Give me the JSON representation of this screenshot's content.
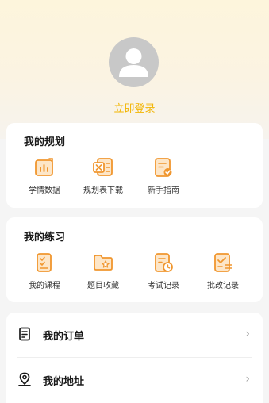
{
  "profile": {
    "login_text": "立即登录"
  },
  "planning": {
    "title": "我的规划",
    "items": [
      {
        "label": "学情数据",
        "icon": "bar-chart-icon"
      },
      {
        "label": "规划表下载",
        "icon": "excel-download-icon"
      },
      {
        "label": "新手指南",
        "icon": "guide-icon"
      }
    ]
  },
  "practice": {
    "title": "我的练习",
    "items": [
      {
        "label": "我的课程",
        "icon": "course-icon"
      },
      {
        "label": "题目收藏",
        "icon": "star-folder-icon"
      },
      {
        "label": "考试记录",
        "icon": "exam-clock-icon"
      },
      {
        "label": "批改记录",
        "icon": "correction-icon"
      }
    ]
  },
  "menu": {
    "orders": {
      "label": "我的订单",
      "icon": "order-icon"
    },
    "address": {
      "label": "我的地址",
      "icon": "location-icon"
    }
  },
  "colors": {
    "accent": "#f2b400",
    "icon_orange": "#f0962e"
  }
}
